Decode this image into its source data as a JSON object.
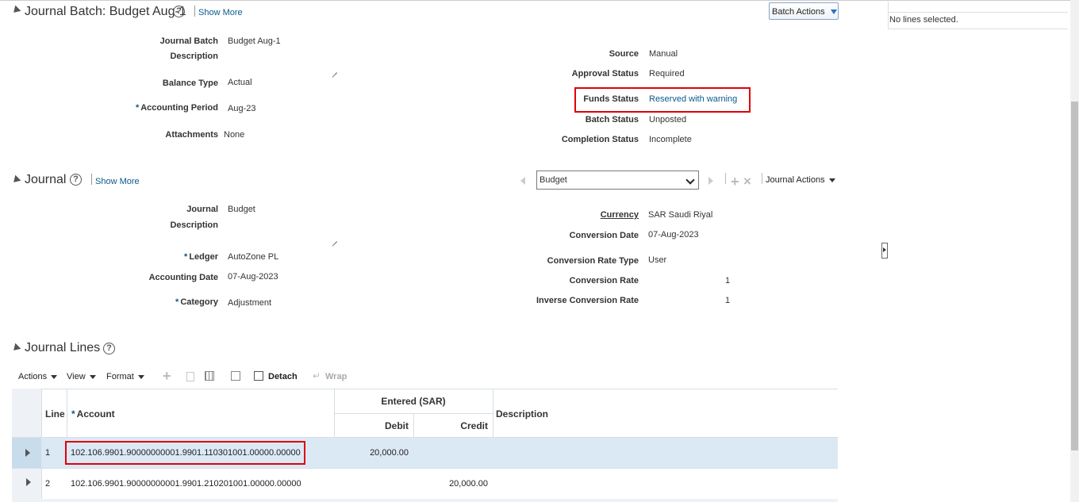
{
  "batch": {
    "title": "Journal Batch: Budget Aug-1",
    "show_more": "Show More",
    "actions_label": "Batch Actions",
    "fields_left": [
      {
        "label": "Journal Batch",
        "value": "Budget Aug-1"
      },
      {
        "label": "Description",
        "value": ""
      },
      {
        "label": "Balance Type",
        "value": "Actual"
      },
      {
        "label": "Accounting Period",
        "value": "Aug-23",
        "required": true
      },
      {
        "label": "Attachments",
        "value": "None"
      }
    ],
    "fields_right": [
      {
        "label": "Source",
        "value": "Manual"
      },
      {
        "label": "Approval Status",
        "value": "Required"
      },
      {
        "label": "Funds Status",
        "value": "Reserved with warning"
      },
      {
        "label": "Batch Status",
        "value": "Unposted"
      },
      {
        "label": "Completion Status",
        "value": "Incomplete"
      }
    ]
  },
  "right_panel": {
    "no_lines": "No lines selected."
  },
  "journal": {
    "title": "Journal",
    "show_more": "Show More",
    "selector_value": "Budget",
    "actions_label": "Journal Actions",
    "fields_left": [
      {
        "label": "Journal",
        "value": "Budget"
      },
      {
        "label": "Description",
        "value": ""
      },
      {
        "label": "Ledger",
        "value": "AutoZone PL",
        "required": true
      },
      {
        "label": "Accounting Date",
        "value": "07-Aug-2023"
      },
      {
        "label": "Category",
        "value": "Adjustment",
        "required": true
      }
    ],
    "fields_right": [
      {
        "label": "Currency",
        "value": "SAR Saudi Riyal"
      },
      {
        "label": "Conversion Date",
        "value": "07-Aug-2023"
      },
      {
        "label": "Conversion Rate Type",
        "value": "User"
      },
      {
        "label": "Conversion Rate",
        "value": "1"
      },
      {
        "label": "Inverse Conversion Rate",
        "value": "1"
      }
    ]
  },
  "lines": {
    "title": "Journal Lines",
    "toolbar": {
      "actions": "Actions",
      "view": "View",
      "format": "Format",
      "detach": "Detach",
      "wrap": "Wrap"
    },
    "headers": {
      "line": "Line",
      "account": "Account",
      "entered": "Entered (SAR)",
      "debit": "Debit",
      "credit": "Credit",
      "description": "Description"
    },
    "rows": [
      {
        "line": "1",
        "account": "102.106.9901.90000000001.9901.110301001.00000.00000",
        "debit": "20,000.00",
        "credit": "",
        "description": ""
      },
      {
        "line": "2",
        "account": "102.106.9901.90000000001.9901.210201001.00000.00000",
        "debit": "",
        "credit": "20,000.00",
        "description": ""
      }
    ]
  }
}
